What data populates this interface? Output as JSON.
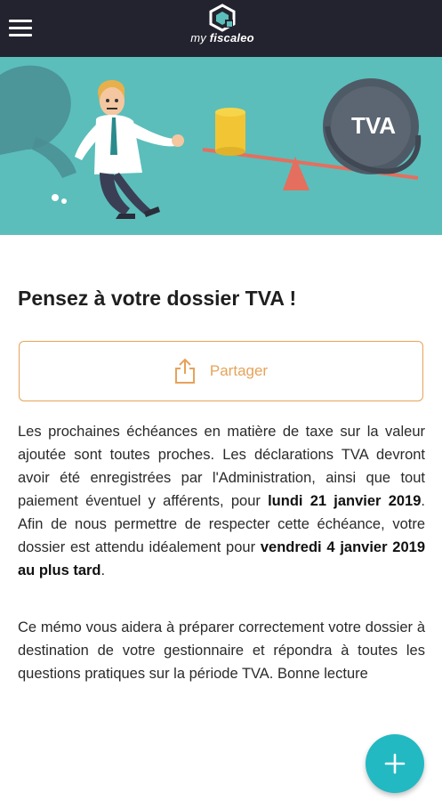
{
  "header": {
    "menu_icon": "hamburger-menu-icon",
    "logo_text_prefix": "my",
    "logo_text_brand": "fiscaleo"
  },
  "hero": {
    "coin_label": "TVA"
  },
  "article": {
    "title": "Pensez à votre dossier TVA !",
    "share_label": "Partager",
    "share_icon": "share-icon",
    "p1_a": "Les prochaines échéances en matière de taxe sur la valeur ajoutée sont toutes proches. Les déclarations TVA devront avoir été enregistrées par l'Administration, ainsi que tout paiement éventuel y afférents, pour ",
    "p1_b": "lundi 21 janvier 2019",
    "p1_c": ". Afin de nous permettre de respecter cette échéance, votre dossier est attendu idéalement pour ",
    "p1_d": "vendredi 4 janvier 2019 au plus tard",
    "p1_e": ".",
    "p2": "Ce mémo vous aidera à préparer correctement votre dossier à destination de votre gestionnaire et répondra à toutes les questions pratiques sur la période TVA. Bonne lecture"
  },
  "fab": {
    "icon": "plus-icon"
  },
  "colors": {
    "topbar": "#23232f",
    "hero_bg": "#5bbebb",
    "accent_orange": "#e6a35a",
    "fab": "#22b9c2"
  }
}
